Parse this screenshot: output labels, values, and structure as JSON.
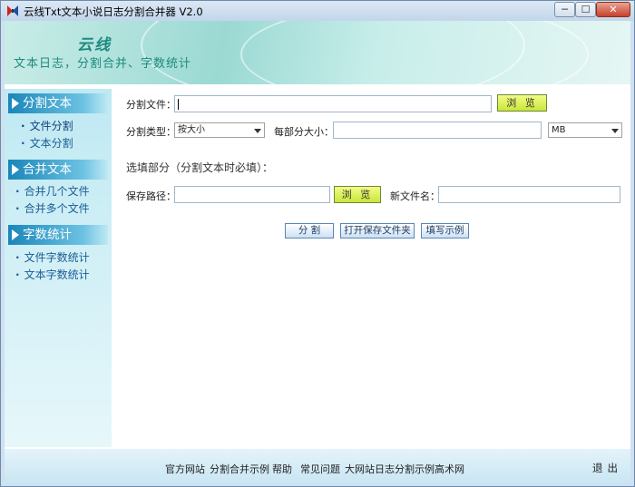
{
  "window": {
    "title": "云线Txt文本小说日志分割合并器 V2.0",
    "controls": {
      "minimize": "─",
      "maximize": "☐",
      "close": "✕"
    }
  },
  "banner": {
    "logo": "云线",
    "subtitle": "文本日志，分割合并、字数统计"
  },
  "sidebar": {
    "sections": [
      {
        "title": "分割文本",
        "items": [
          "文件分割",
          "文本分割"
        ]
      },
      {
        "title": "合并文本",
        "items": [
          "合并几个文件",
          "合并多个文件"
        ]
      },
      {
        "title": "字数统计",
        "items": [
          "文件字数统计",
          "文本字数统计"
        ]
      }
    ]
  },
  "form": {
    "split_file_label": "分割文件：",
    "split_file_value": "",
    "browse_label": "浏 览",
    "split_type_label": "分割类型：",
    "split_type_value": "按大小",
    "part_size_label": "每部分大小：",
    "part_size_value": "",
    "unit_value": "MB",
    "optional_title": "选填部分（分割文本时必填）：",
    "save_path_label": "保存路径：",
    "save_path_value": "",
    "browse2_label": "浏 览",
    "new_name_label": "新文件名：",
    "new_name_value": ""
  },
  "actions": {
    "split": "分 割",
    "open_folder": "打开保存文件夹",
    "fill_example": "填写示例"
  },
  "footer": {
    "links": [
      "官方网站",
      "分割合并示例",
      "帮助",
      "常见问题",
      "大网站日志分割示例",
      "高术网"
    ],
    "exit": "退出"
  }
}
